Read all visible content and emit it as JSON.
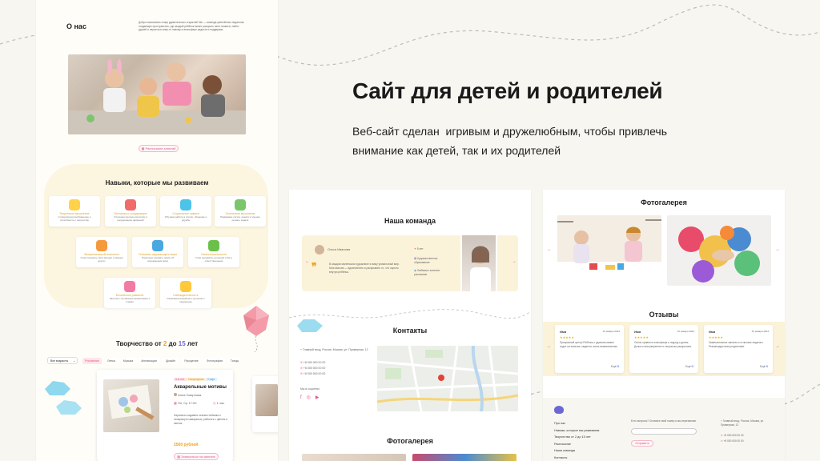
{
  "hero": {
    "title": "Сайт для детей и родителей",
    "subtitle_line1": "Веб-сайт сделан  игривым и дружелюбным, чтобы привлечь",
    "subtitle_line2": "внимание как детей, так и их родителей"
  },
  "left_page": {
    "about_title": "О нас",
    "about_text": "Добро пожаловать в мир удивительных открытий! Мы — команда увлечённых педагогов, создающих пространство, где каждый ребёнок может раскрыть свои таланты, найти друзей и научиться чему-то новому в атмосфере радости и поддержки.",
    "schedule_button": "Расписание занятий",
    "skills_title": "Навыки, которые мы развиваем",
    "skills": [
      {
        "title": "Творческое мышление",
        "desc": "Стимулируем воображение и способность к творчеству",
        "color": "#ffd24a"
      },
      {
        "title": "Моторика и координация",
        "desc": "Улучшаем мелкую моторику и координацию движений",
        "color": "#f26b6b"
      },
      {
        "title": "Социальные навыки",
        "desc": "Обучаем работе в группе, общению и дружбе",
        "color": "#4cc3e8"
      },
      {
        "title": "Логическое мышление",
        "desc": "Развиваем логику, анализ и умение решать задачи",
        "color": "#7bc66a"
      },
      {
        "title": "Эмоциональный интеллект",
        "desc": "Учим понимать свои эмоции и эмоции других",
        "color": "#f59a3c"
      },
      {
        "title": "Познание окружающего мира",
        "desc": "Помогаем узнавать новое об окружающем мире",
        "color": "#4aa8e0"
      },
      {
        "title": "Самостоятельность",
        "desc": "Учим принимать решения и быть ответственными",
        "color": "#6cc04a"
      },
      {
        "title": "Физическое развитие",
        "desc": "Занятия с активными движениями и играми",
        "color": "#f27aa5"
      },
      {
        "title": "Наблюдательность",
        "desc": "Развиваем внимание к деталям и окружению",
        "color": "#ffc93d"
      }
    ],
    "creativity_title_pre": "Творчество от ",
    "creativity_age_from": "2",
    "creativity_mid": " до ",
    "creativity_age_to": "15",
    "creativity_post": " лет",
    "age_select": "Все возрасты",
    "tags": [
      "Рисование",
      "Лепка",
      "Музыка",
      "Аппликация",
      "Дизайн",
      "Рукоделие",
      "Фотография",
      "Танцы"
    ],
    "course": {
      "badge_age": "5-8 лет",
      "badge_popular": "Популярное",
      "badge_extra": "Старт",
      "title": "Акварельные мотивы",
      "teacher": "Анна Смирнова",
      "schedule": "Пн, Ср 17:00",
      "duration": "1 час",
      "desc": "Научимся создавать нежные пейзажи и натюрморты акварелью, работать с цветом и светом.",
      "price": "2500 рублей",
      "button": "Записаться на занятие"
    }
  },
  "team_page": {
    "title": "Наша команда",
    "member_name": "Ольга Иванова",
    "member_role": "Педагог",
    "quote": "В каждом маленьком художнике я вижу уникальный мир. Моя миссия — вдохновлять и раскрывать то, что скрыто внутри ребёнка.",
    "facts": [
      "5 лет",
      "Художественное образование",
      "Любимые занятия: рисование"
    ],
    "contacts_title": "Контакты",
    "address": "Главный вход, Россия, Москва, ул. Примерная, 12",
    "phones": [
      "+8 000 000 00 00",
      "+8 000 000 00 00",
      "+8 000 000 00 00"
    ],
    "social_label": "Мы в соцсетях:",
    "gallery_title": "Фотогалерея"
  },
  "right_page": {
    "gallery_title": "Фотогалерея",
    "reviews_title": "Отзывы",
    "reviews": [
      {
        "name": "Имя",
        "date": "15 января 2024",
        "text": "Прекрасный центр! Ребёнок с удовольствием ходит на занятия, педагоги очень внимательные."
      },
      {
        "name": "Имя",
        "date": "15 января 2024",
        "text": "Очень нравится атмосфера и подход к детям. Дочка стала увереннее и творчески раскрылась."
      },
      {
        "name": "Имя",
        "date": "15 января 2024",
        "text": "Замечательные занятия и отличные педагоги. Рекомендую всем родителям!"
      }
    ],
    "read_more": "Ещё",
    "footer_links": [
      "Про нас",
      "Навыки, которые мы развиваем",
      "Творчество от 2 до 15 лет",
      "Расписание",
      "Наша команда",
      "Контакты"
    ],
    "footer_question": "Есть вопросы? Оставьте свой номер и мы перезвоним",
    "footer_button": "Отправить",
    "footer_address": "Главный вход, Россия, Москва, ул. Примерная, 12",
    "footer_phones": [
      "+8 000 000 00 00",
      "+8 000 000 00 00"
    ]
  }
}
